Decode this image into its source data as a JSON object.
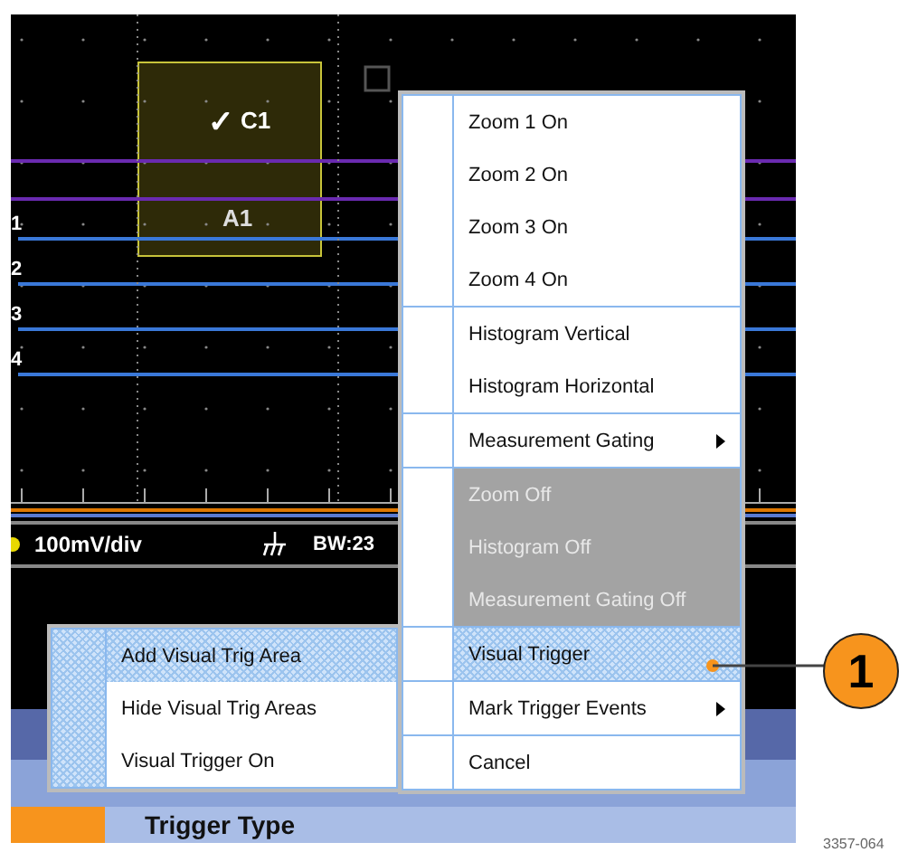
{
  "scope": {
    "channel_box": {
      "check": "✓",
      "label": "C1",
      "sublabel": "A1"
    },
    "trace_labels": [
      "1",
      "2",
      "3",
      "4"
    ],
    "status": {
      "scale": "100mV/div",
      "bandwidth": "BW:23"
    }
  },
  "context_menu": {
    "groups": [
      {
        "items": [
          {
            "label": "Zoom 1 On",
            "disabled": false,
            "selected": false,
            "submenu": false
          },
          {
            "label": "Zoom 2 On",
            "disabled": false,
            "selected": false,
            "submenu": false
          },
          {
            "label": "Zoom 3 On",
            "disabled": false,
            "selected": false,
            "submenu": false
          },
          {
            "label": "Zoom 4 On",
            "disabled": false,
            "selected": false,
            "submenu": false
          }
        ]
      },
      {
        "items": [
          {
            "label": "Histogram Vertical",
            "disabled": false,
            "selected": false,
            "submenu": false
          },
          {
            "label": "Histogram Horizontal",
            "disabled": false,
            "selected": false,
            "submenu": false
          }
        ]
      },
      {
        "items": [
          {
            "label": "Measurement Gating",
            "disabled": false,
            "selected": false,
            "submenu": true
          }
        ]
      },
      {
        "items": [
          {
            "label": "Zoom Off",
            "disabled": true,
            "selected": false,
            "submenu": false
          },
          {
            "label": "Histogram Off",
            "disabled": true,
            "selected": false,
            "submenu": false
          },
          {
            "label": "Measurement Gating Off",
            "disabled": true,
            "selected": false,
            "submenu": false
          }
        ]
      },
      {
        "items": [
          {
            "label": "Visual Trigger",
            "disabled": false,
            "selected": true,
            "submenu": false
          }
        ]
      },
      {
        "items": [
          {
            "label": "Mark Trigger Events",
            "disabled": false,
            "selected": false,
            "submenu": true
          }
        ]
      },
      {
        "items": [
          {
            "label": "Cancel",
            "disabled": false,
            "selected": false,
            "submenu": false
          }
        ]
      }
    ]
  },
  "submenu": {
    "items": [
      {
        "label": "Add Visual Trig Area",
        "selected": true
      },
      {
        "label": "Hide Visual Trig Areas",
        "selected": false
      },
      {
        "label": "Visual Trigger On",
        "selected": false
      }
    ]
  },
  "bottom_panel": {
    "title": "Trigger Type"
  },
  "callout": {
    "label": "1"
  },
  "figure_number": "3357-064"
}
